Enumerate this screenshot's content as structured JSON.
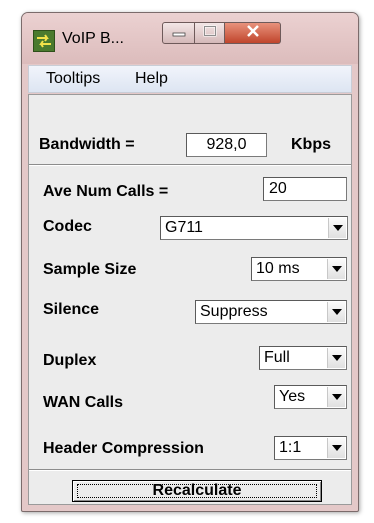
{
  "window": {
    "title": "VoIP B...",
    "icon": "app-icon",
    "controls": {
      "minimize": "minimize-icon",
      "maximize": "maximize-icon",
      "close": "close-icon"
    }
  },
  "menu": {
    "items": [
      "Tooltips",
      "Help"
    ]
  },
  "bandwidth": {
    "label": "Bandwidth =",
    "value": "928,0",
    "unit": "Kbps"
  },
  "fields": {
    "ave_num_calls": {
      "label": "Ave Num Calls =",
      "value": "20"
    },
    "codec": {
      "label": "Codec",
      "value": "G711"
    },
    "sample_size": {
      "label": "Sample Size",
      "value": "10 ms"
    },
    "silence": {
      "label": "Silence",
      "value": "Suppress"
    },
    "duplex": {
      "label": "Duplex",
      "value": "Full"
    },
    "wan_calls": {
      "label": "WAN Calls",
      "value": "Yes"
    },
    "header_compression": {
      "label": "Header Compression",
      "value": "1:1"
    }
  },
  "actions": {
    "recalculate": "Recalculate"
  },
  "colors": {
    "titlebar": "#e2c4c4",
    "close_button": "#c9543a",
    "menubar": "#e6ecf7",
    "panel": "#ececec"
  }
}
